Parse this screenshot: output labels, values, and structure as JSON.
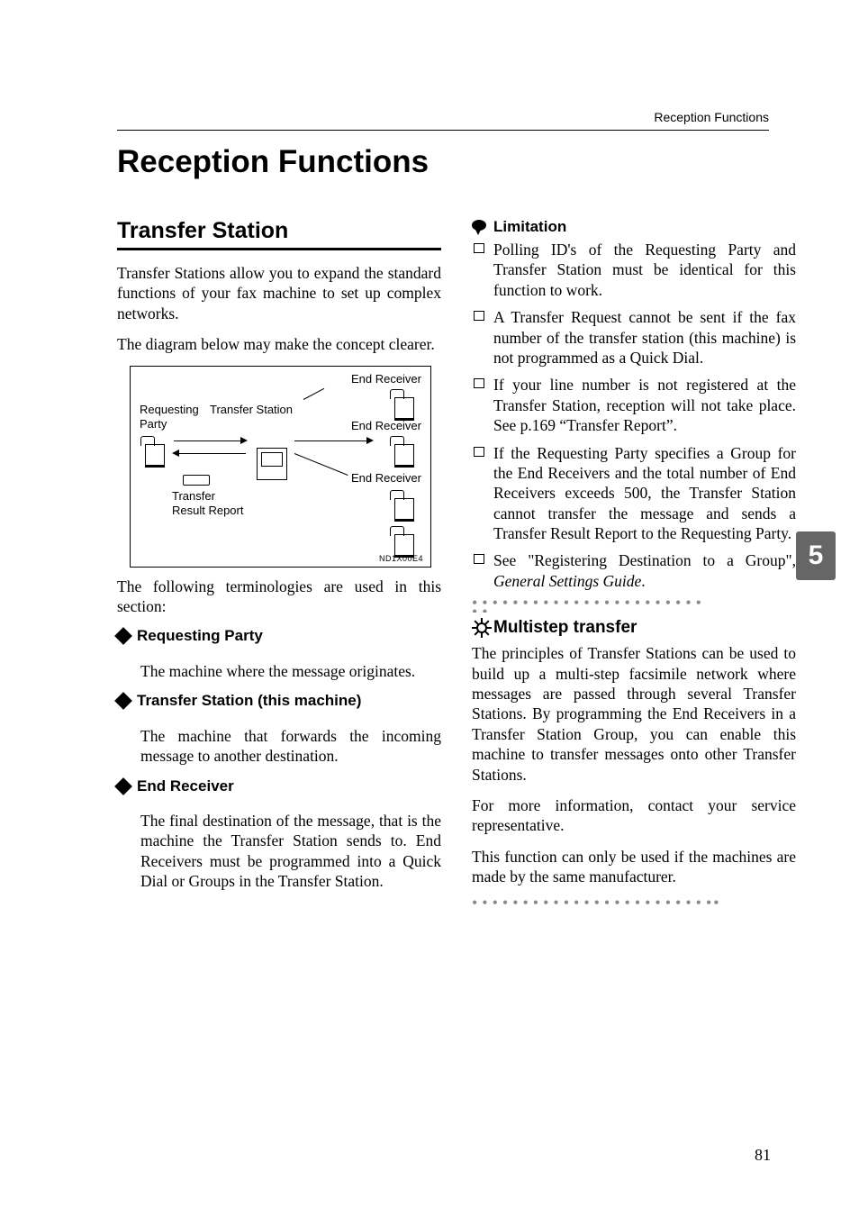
{
  "running_head": "Reception Functions",
  "h1": "Reception Functions",
  "side_tab": "5",
  "page_number": "81",
  "left": {
    "h2": "Transfer Station",
    "p1": "Transfer Stations allow you to expand the standard functions of your fax machine to set up complex networks.",
    "p2": "The diagram below may make the concept clearer.",
    "p3": "The following terminologies are used in this section:",
    "diagram": {
      "end_receiver": "End Receiver",
      "requesting_party_a": "Requesting",
      "requesting_party_b": "Party",
      "transfer_station": "Transfer Station",
      "transfer": "Transfer",
      "result_report": "Result Report",
      "code": "ND1X00E4"
    },
    "items": [
      {
        "title": "Requesting Party",
        "body": "The machine where the message originates."
      },
      {
        "title": "Transfer Station (this machine)",
        "body": "The machine that forwards the incoming message to another destination."
      },
      {
        "title": "End Receiver",
        "body": "The final destination of the message, that is the machine the Transfer Station sends to. End Receivers must be programmed into a Quick Dial or Groups in the Transfer Station."
      }
    ]
  },
  "right": {
    "limitation_label": "Limitation",
    "bullets": [
      "Polling ID's of the Requesting Party and Transfer Station must be identical for this function to work.",
      "A Transfer Request cannot be sent if the fax number of the transfer station (this machine) is not programmed as a Quick Dial.",
      "If your line number is not registered at the Transfer Station, reception will not take place. See p.169 “Transfer Report”.",
      "If the Requesting Party specifies a Group for the End Receivers and the total number of End Receivers exceeds 500, the Transfer Station cannot transfer the message and sends a Transfer Result Report to the Requesting Party."
    ],
    "see_prefix": "See \"Registering Destination to a Group\", ",
    "see_italic": "General Settings Guide",
    "see_suffix": ".",
    "multistep_title": "Multistep transfer",
    "mp1": "The principles of Transfer Stations can be used to build up a multi-step facsimile network where messages are passed through several Transfer Stations. By programming the End Receivers in a Transfer Station Group, you can enable this machine to transfer messages onto other Transfer Stations.",
    "mp2": "For more information, contact your service representative.",
    "mp3": "This function can only be used if the machines are made by the same manufacturer."
  }
}
